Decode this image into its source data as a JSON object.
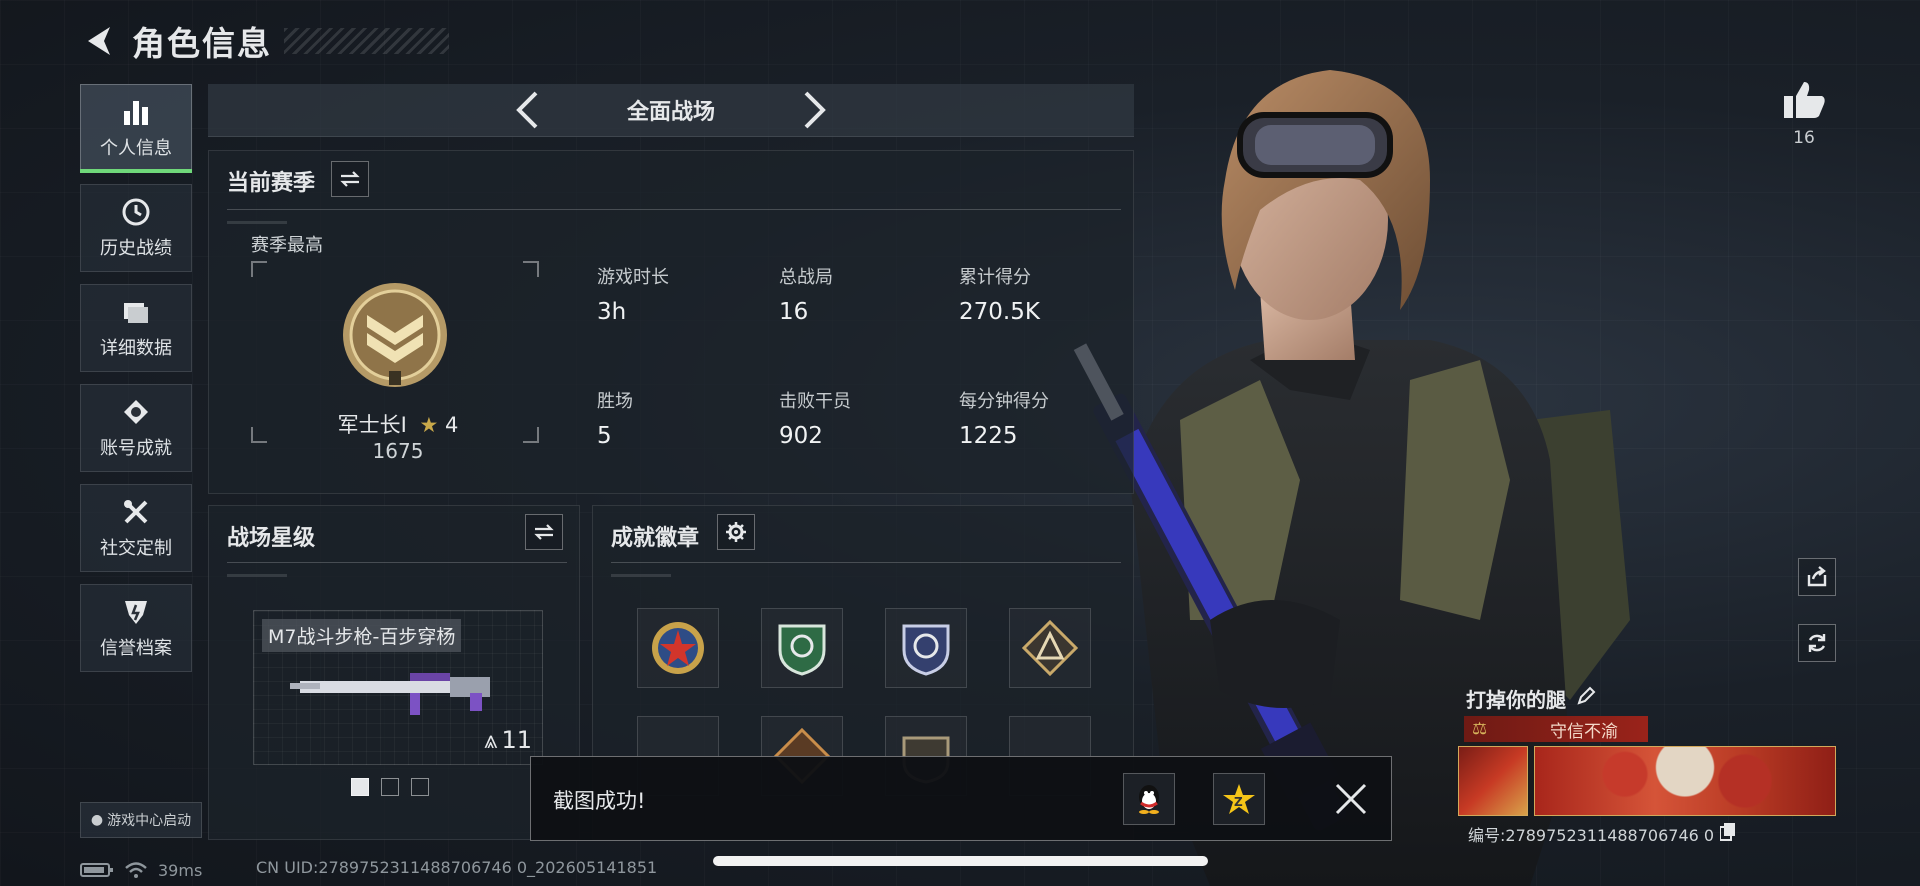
{
  "header": {
    "title": "角色信息"
  },
  "sidebar": {
    "items": [
      {
        "label": "个人信息",
        "icon": "bar-chart-icon",
        "active": true
      },
      {
        "label": "历史战绩",
        "icon": "history-icon"
      },
      {
        "label": "详细数据",
        "icon": "folder-icon"
      },
      {
        "label": "账号成就",
        "icon": "achievement-icon"
      },
      {
        "label": "社交定制",
        "icon": "tools-icon"
      },
      {
        "label": "信誉档案",
        "icon": "shield-icon"
      }
    ],
    "launch_label": "游戏中心启动"
  },
  "mode": {
    "label": "全面战场"
  },
  "season": {
    "title": "当前赛季",
    "best_label": "赛季最高",
    "rank_name": "军士长Ⅰ",
    "rank_stars": "4",
    "rank_score": "1675",
    "stats": [
      {
        "key": "游戏时长",
        "value": "3h"
      },
      {
        "key": "总战局",
        "value": "16"
      },
      {
        "key": "累计得分",
        "value": "270.5K"
      },
      {
        "key": "胜场",
        "value": "5"
      },
      {
        "key": "击败干员",
        "value": "902"
      },
      {
        "key": "每分钟得分",
        "value": "1225"
      }
    ]
  },
  "battlefield_star": {
    "title": "战场星级",
    "weapon_name": "M7战斗步枪-百步穿杨",
    "weapon_level": "11",
    "pager": {
      "count": 3,
      "active": 1
    }
  },
  "achievements": {
    "title": "成就徽章",
    "badges": [
      "badge-star-medal",
      "badge-green-shield",
      "badge-blue-shield",
      "badge-triangle",
      "",
      "badge-dragon",
      "badge-helmet",
      ""
    ]
  },
  "toast": {
    "message": "截图成功!"
  },
  "status": {
    "ping": "39ms",
    "uid_line": "CN UID:2789752311488706746 0_202605141851"
  },
  "profile": {
    "likes": "16",
    "player_name": "打掉你的腿",
    "title_tag": "守信不渝",
    "player_id": "编号:2789752311488706746 0"
  },
  "colors": {
    "accent_green": "#6fd87a",
    "title_red": "#9a231a",
    "gold": "#c9a94a"
  }
}
